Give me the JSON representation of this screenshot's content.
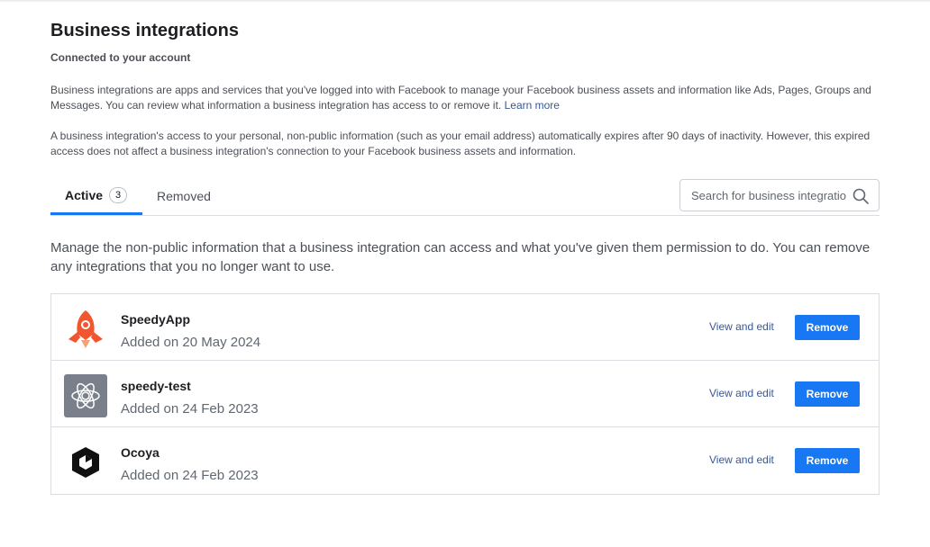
{
  "header": {
    "title": "Business integrations",
    "subtitle": "Connected to your account"
  },
  "intro": {
    "paragraph1": "Business integrations are apps and services that you've logged into with Facebook to manage your Facebook business assets and information like Ads, Pages, Groups and Messages. You can review what information a business integration has access to or remove it.",
    "learn_more": "Learn more",
    "paragraph2": "A business integration's access to your personal, non-public information (such as your email address) automatically expires after 90 days of inactivity. However, this expired access does not affect a business integration's connection to your Facebook business assets and information."
  },
  "tabs": [
    {
      "label": "Active",
      "count": "3",
      "active": true
    },
    {
      "label": "Removed",
      "active": false
    }
  ],
  "search": {
    "placeholder": "Search for business integrations",
    "value": ""
  },
  "manage_text": "Manage the non-public information that a business integration can access and what you've given them permission to do. You can remove any integrations that you no longer want to use.",
  "integrations": [
    {
      "name": "SpeedyApp",
      "date": "Added on 20 May 2024",
      "icon": "rocket-icon",
      "view_label": "View and edit",
      "remove_label": "Remove"
    },
    {
      "name": "speedy-test",
      "date": "Added on 24 Feb 2023",
      "icon": "atom-icon",
      "view_label": "View and edit",
      "remove_label": "Remove"
    },
    {
      "name": "Ocoya",
      "date": "Added on 24 Feb 2023",
      "icon": "ocoya-logo-icon",
      "view_label": "View and edit",
      "remove_label": "Remove"
    }
  ],
  "colors": {
    "accent": "#1877f2",
    "link": "#385898",
    "speedyapp_brand": "#f2562f",
    "speedytest_bg": "#7a808b"
  }
}
